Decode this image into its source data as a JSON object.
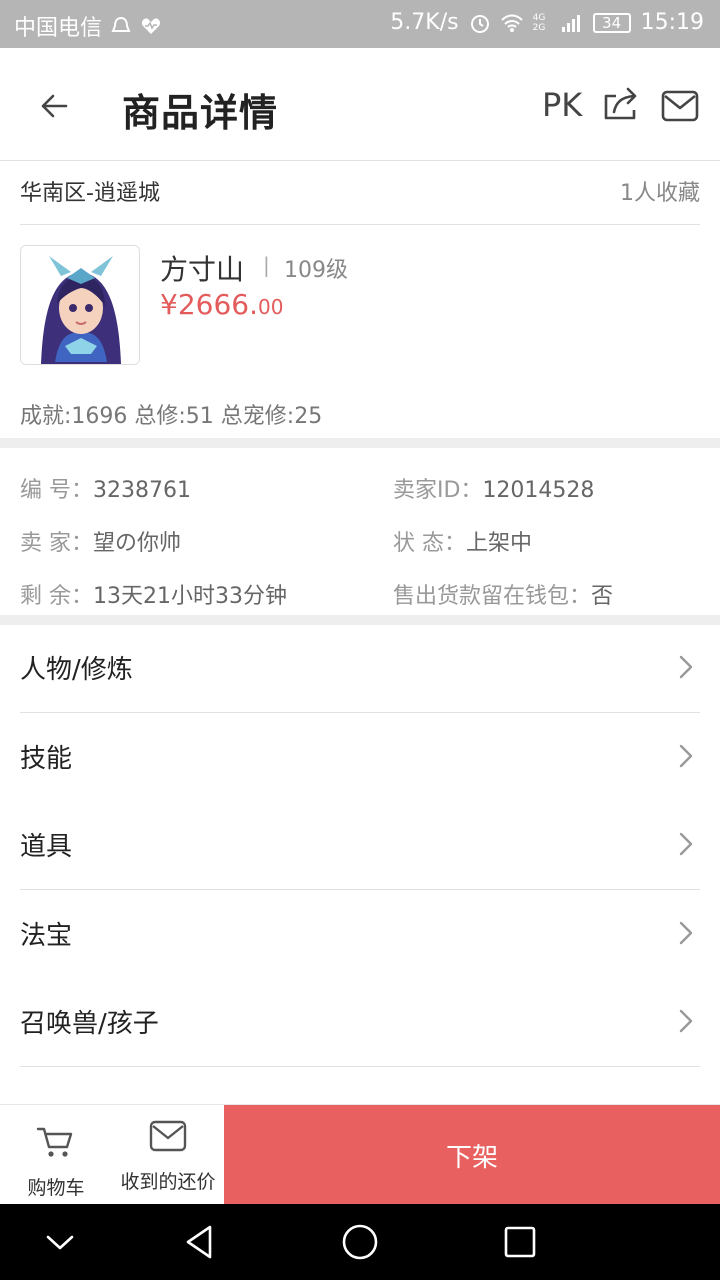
{
  "status_bar": {
    "carrier": "中国电信",
    "net_speed": "5.7K/s",
    "battery": "34",
    "time": "15:19",
    "signal_tag": "4G 2G"
  },
  "header": {
    "title": "商品详情",
    "pk_label": "PK"
  },
  "listing": {
    "region": "华南区-逍遥城",
    "favorites": "1人收藏",
    "character": {
      "school": "方寸山",
      "level": "109级",
      "price_main": "¥2666.",
      "price_decimal": "00",
      "stats": "成就:1696 总修:51 总宠修:25"
    }
  },
  "info": {
    "serial_label": "编 号：",
    "serial_value": "3238761",
    "seller_id_label": "卖家ID：",
    "seller_id_value": "12014528",
    "seller_label": "卖 家：",
    "seller_value": "望の你帅",
    "status_label": "状 态：",
    "status_value": "上架中",
    "remaining_label": "剩 余：",
    "remaining_value": "13天21小时33分钟",
    "wallet_label": "售出货款留在钱包：",
    "wallet_value": "否"
  },
  "menu": [
    {
      "label": "人物/修炼"
    },
    {
      "label": "技能"
    },
    {
      "label": "道具"
    },
    {
      "label": "法宝"
    },
    {
      "label": "召唤兽/孩子"
    }
  ],
  "bottom_bar": {
    "cart_label": "购物车",
    "offers_label": "收到的还价",
    "delist_label": "下架"
  },
  "colors": {
    "accent": "#e86060",
    "price": "#e45b5b"
  }
}
